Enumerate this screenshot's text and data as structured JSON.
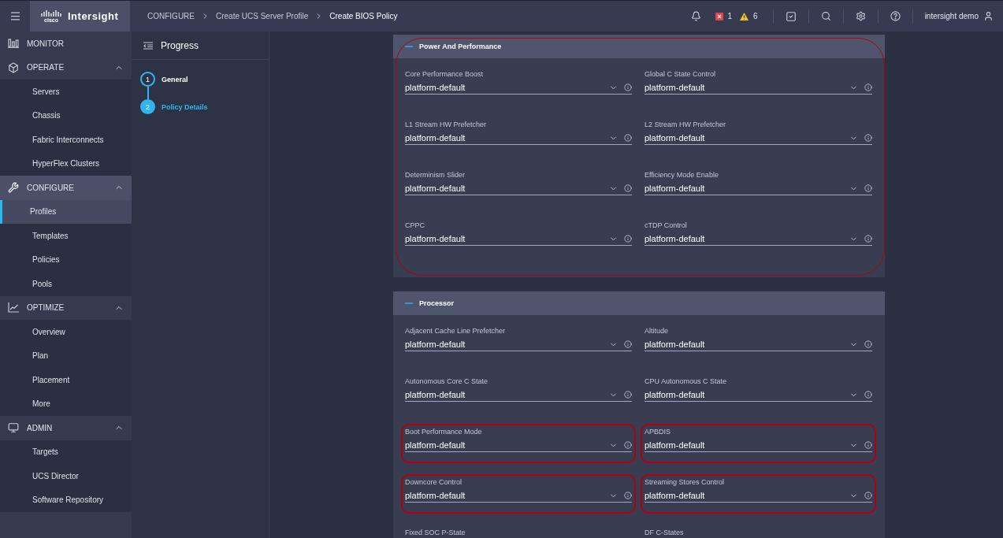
{
  "header": {
    "logo_mark": "cisco",
    "product": "Intersight",
    "breadcrumb": [
      "CONFIGURE",
      "Create UCS Server Profile",
      "Create BIOS Policy"
    ],
    "error_count": "1",
    "warning_count": "6",
    "user": "intersight demo"
  },
  "sidebar": {
    "items": [
      {
        "kind": "section",
        "label": "MONITOR",
        "active": false
      },
      {
        "kind": "section",
        "label": "OPERATE",
        "active": false,
        "expanded": true
      },
      {
        "kind": "item",
        "label": "Servers",
        "selected": false
      },
      {
        "kind": "item",
        "label": "Chassis",
        "selected": false
      },
      {
        "kind": "item",
        "label": "Fabric Interconnects",
        "selected": false
      },
      {
        "kind": "item",
        "label": "HyperFlex Clusters",
        "selected": false
      },
      {
        "kind": "section",
        "label": "CONFIGURE",
        "active": true,
        "expanded": true
      },
      {
        "kind": "item",
        "label": "Profiles",
        "selected": true
      },
      {
        "kind": "item",
        "label": "Templates",
        "selected": false
      },
      {
        "kind": "item",
        "label": "Policies",
        "selected": false
      },
      {
        "kind": "item",
        "label": "Pools",
        "selected": false
      },
      {
        "kind": "section",
        "label": "OPTIMIZE",
        "active": false,
        "expanded": true
      },
      {
        "kind": "item",
        "label": "Overview",
        "selected": false
      },
      {
        "kind": "item",
        "label": "Plan",
        "selected": false
      },
      {
        "kind": "item",
        "label": "Placement",
        "selected": false
      },
      {
        "kind": "item",
        "label": "More",
        "selected": false
      },
      {
        "kind": "section",
        "label": "ADMIN",
        "active": false,
        "expanded": true
      },
      {
        "kind": "item",
        "label": "Targets",
        "selected": false
      },
      {
        "kind": "item",
        "label": "UCS Director",
        "selected": false
      },
      {
        "kind": "item",
        "label": "Software Repository",
        "selected": false
      }
    ]
  },
  "progress": {
    "title": "Progress",
    "steps": [
      {
        "number": "1",
        "label": "General",
        "selected": false
      },
      {
        "number": "2",
        "label": "Policy Details",
        "selected": true
      }
    ]
  },
  "sections": [
    {
      "title": "Power And Performance",
      "expanded": true,
      "highlighted": true,
      "fields": [
        {
          "label": "Core Performance Boost",
          "value": "platform-default",
          "highlighted": false
        },
        {
          "label": "Global C State Control",
          "value": "platform-default",
          "highlighted": false
        },
        {
          "label": "L1 Stream HW Prefetcher",
          "value": "platform-default",
          "highlighted": false
        },
        {
          "label": "L2 Stream HW Prefetcher",
          "value": "platform-default",
          "highlighted": false
        },
        {
          "label": "Determinism Slider",
          "value": "platform-default",
          "highlighted": false
        },
        {
          "label": "Efficiency Mode Enable",
          "value": "platform-default",
          "highlighted": false
        },
        {
          "label": "CPPC",
          "value": "platform-default",
          "highlighted": false
        },
        {
          "label": "cTDP Control",
          "value": "platform-default",
          "highlighted": false
        }
      ]
    },
    {
      "title": "Processor",
      "expanded": true,
      "highlighted": false,
      "fields": [
        {
          "label": "Adjacent Cache Line Prefetcher",
          "value": "platform-default",
          "highlighted": false
        },
        {
          "label": "Altitude",
          "value": "platform-default",
          "highlighted": false
        },
        {
          "label": "Autonomous Core C State",
          "value": "platform-default",
          "highlighted": false
        },
        {
          "label": "CPU Autonomous C State",
          "value": "platform-default",
          "highlighted": false
        },
        {
          "label": "Boot Performance Mode",
          "value": "platform-default",
          "highlighted": true
        },
        {
          "label": "APBDIS",
          "value": "platform-default",
          "highlighted": true
        },
        {
          "label": "Downcore Control",
          "value": "platform-default",
          "highlighted": true
        },
        {
          "label": "Streaming Stores Control",
          "value": "platform-default",
          "highlighted": true
        },
        {
          "label": "Fixed SOC P-State",
          "highlighted": false
        },
        {
          "label": "DF C-States",
          "highlighted": false
        }
      ]
    }
  ]
}
